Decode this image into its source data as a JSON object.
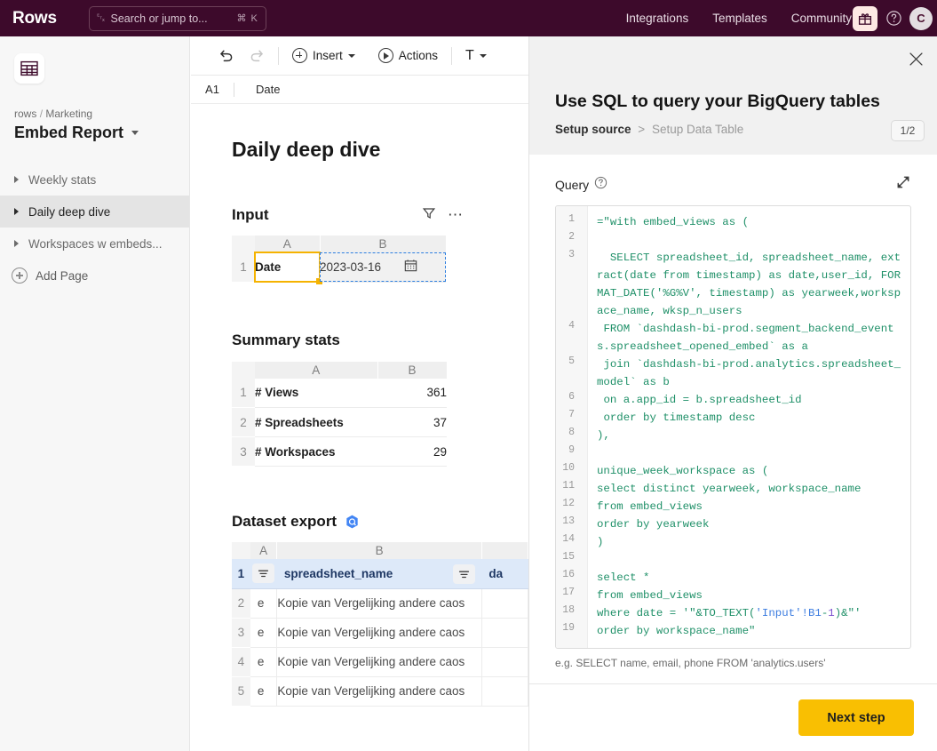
{
  "topbar": {
    "brand": "Rows",
    "search": {
      "placeholder": "Search or jump to...",
      "shortcut": "⌘ K",
      "icon": "lightning-icon"
    },
    "nav": [
      {
        "label": "Integrations"
      },
      {
        "label": "Templates"
      },
      {
        "label": "Community"
      }
    ],
    "gift_icon": "gift-icon",
    "help_icon": "question-circle-icon",
    "avatar_initial": "C",
    "bg_color": "#3d0a2b"
  },
  "sidebar": {
    "app_icon": "spreadsheet-grid-icon",
    "breadcrumb": {
      "workspace": "rows",
      "separator": "/",
      "folder": "Marketing"
    },
    "doc_title": "Embed Report",
    "pages": [
      {
        "label": "Weekly stats",
        "active": false
      },
      {
        "label": "Daily deep dive",
        "active": true
      },
      {
        "label": "Workspaces w embeds...",
        "active": false
      }
    ],
    "add_page_label": "Add Page"
  },
  "toolbar": {
    "undo_icon": "undo-icon",
    "redo_icon": "redo-icon",
    "insert_label": "Insert",
    "actions_label": "Actions",
    "text_format_label": "T"
  },
  "formula_bar": {
    "cell_ref": "A1",
    "value": "Date"
  },
  "canvas": {
    "page_heading": "Daily deep dive",
    "sections": [
      {
        "title": "Input",
        "tools": [
          "filter-icon",
          "more-options-icon"
        ],
        "columns": [
          "A",
          "B"
        ],
        "rows": [
          {
            "num": "1",
            "a": "Date",
            "b": "2023-03-16",
            "b_icon": "calendar-icon"
          }
        ]
      },
      {
        "title": "Summary stats",
        "columns": [
          "A",
          "B"
        ],
        "rows": [
          {
            "num": "1",
            "a": "# Views",
            "b": "361"
          },
          {
            "num": "2",
            "a": "# Spreadsheets",
            "b": "37"
          },
          {
            "num": "3",
            "a": "# Workspaces",
            "b": "29"
          }
        ]
      },
      {
        "title": "Dataset export",
        "badge_icon": "bigquery-icon",
        "columns": [
          "A",
          "B",
          "C"
        ],
        "header_row": {
          "num": "1",
          "a": "",
          "b": "spreadsheet_name",
          "c": "da"
        },
        "rows": [
          {
            "num": "2",
            "a": "e",
            "b": "Kopie van Vergelijking andere caos",
            "c": ""
          },
          {
            "num": "3",
            "a": "e",
            "b": "Kopie van Vergelijking andere caos",
            "c": ""
          },
          {
            "num": "4",
            "a": "e",
            "b": "Kopie van Vergelijking andere caos",
            "c": ""
          },
          {
            "num": "5",
            "a": "e",
            "b": "Kopie van Vergelijking andere caos",
            "c": ""
          }
        ]
      }
    ]
  },
  "panel": {
    "close_icon": "close-icon",
    "title": "Use SQL to query your BigQuery tables",
    "breadcrumb_current": "Setup source",
    "breadcrumb_sep": ">",
    "breadcrumb_next": "Setup Data Table",
    "step_counter": "1/2",
    "query_label": "Query",
    "query_help_icon": "question-circle-icon",
    "expand_icon": "expand-diagonal-icon",
    "line_numbers": [
      "1",
      "2",
      "3",
      "4",
      "5",
      "6",
      "7",
      "8",
      "9",
      "10",
      "11",
      "12",
      "13",
      "14",
      "15",
      "16",
      "17",
      "18",
      "19"
    ],
    "query_lines": [
      "=\"with embed_views as (",
      "",
      "  SELECT spreadsheet_id, spreadsheet_name, extract(date from timestamp) as date,user_id, FORMAT_DATE('%G%V', timestamp) as yearweek,workspace_name, wksp_n_users",
      " FROM `dashdash-bi-prod.segment_backend_events.spreadsheet_opened_embed` as a",
      " join `dashdash-bi-prod.analytics.spreadsheet_model` as b",
      " on a.app_id = b.spreadsheet_id",
      " order by timestamp desc",
      "),",
      "",
      "unique_week_workspace as (",
      "select distinct yearweek, workspace_name",
      "from embed_views",
      "order by yearweek",
      ")",
      "",
      "select *",
      "from embed_views",
      "where date = '\"&TO_TEXT('Input'!B1-1)&\"'",
      "order by workspace_name\""
    ],
    "hint": "e.g. SELECT name, email, phone FROM 'analytics.users'",
    "next_button": "Next step",
    "accent_color": "#f9bf02",
    "code_color": "#1f9068"
  }
}
